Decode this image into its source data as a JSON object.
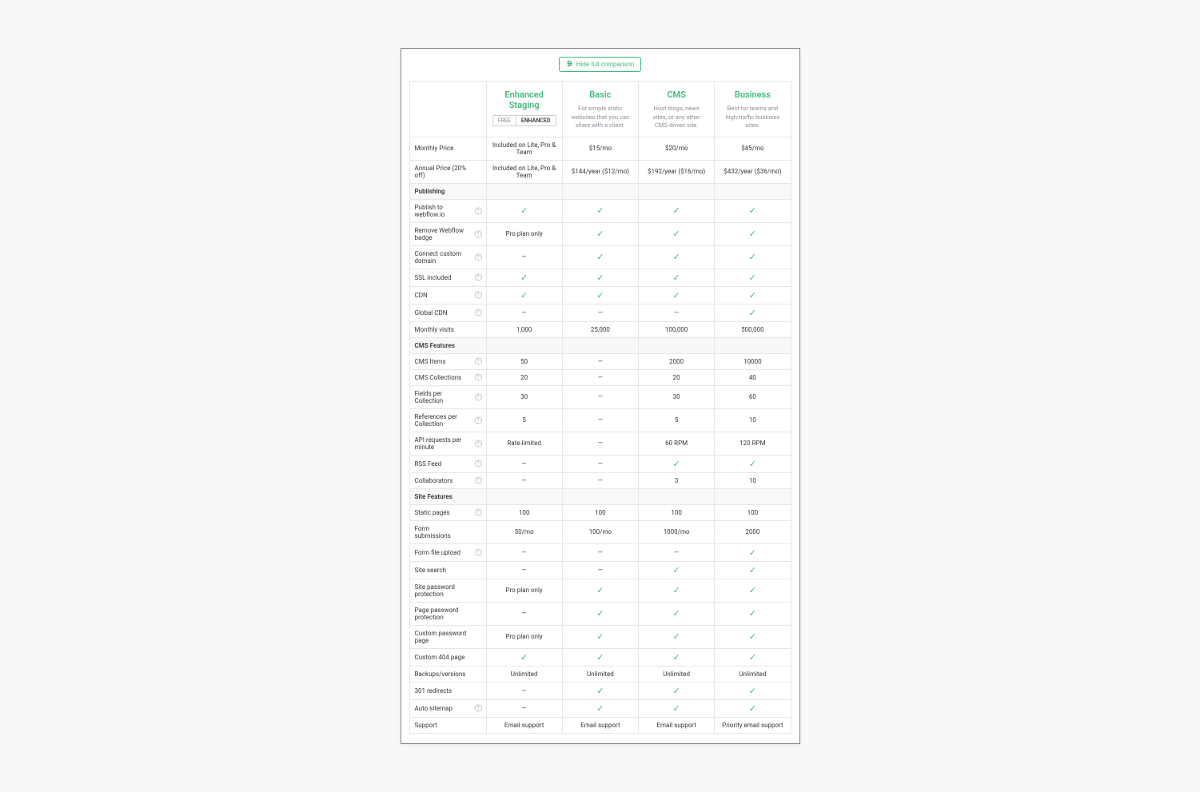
{
  "hide_button": "Hide full comparison",
  "plans": [
    {
      "name": "Enhanced Staging",
      "toggle_free": "FREE",
      "toggle_enhanced": "ENHANCED"
    },
    {
      "name": "Basic",
      "desc": "For simple static websites that you can share with a client."
    },
    {
      "name": "CMS",
      "desc": "Host blogs, news sites, or any other CMS-driven site."
    },
    {
      "name": "Business",
      "desc": "Best for teams and high-traffic business sites."
    }
  ],
  "rows": [
    {
      "label": "Monthly Price",
      "info": false,
      "cells": [
        "Included on Lite, Pro & Team",
        "$15/mo",
        "$20/mo",
        "$45/mo"
      ]
    },
    {
      "label": "Annual Price (20% off)",
      "info": false,
      "cells": [
        "Included on Lite, Pro & Team",
        "$144/year ($12/mo)",
        "$192/year ($16/mo)",
        "$432/year ($36/mo)"
      ]
    },
    {
      "section": "Publishing"
    },
    {
      "label": "Publish to webflow.io",
      "info": true,
      "cells": [
        "check",
        "check",
        "check",
        "check"
      ]
    },
    {
      "label": "Remove Webflow badge",
      "info": true,
      "cells": [
        "Pro plan only",
        "check",
        "check",
        "check"
      ]
    },
    {
      "label": "Connect custom domain",
      "info": true,
      "cells": [
        "dash",
        "check",
        "check",
        "check"
      ]
    },
    {
      "label": "SSL included",
      "info": true,
      "cells": [
        "check",
        "check",
        "check",
        "check"
      ]
    },
    {
      "label": "CDN",
      "info": true,
      "cells": [
        "check",
        "check",
        "check",
        "check"
      ]
    },
    {
      "label": "Global CDN",
      "info": true,
      "cells": [
        "—",
        "—",
        "—",
        "check"
      ]
    },
    {
      "label": "Monthly visits",
      "info": false,
      "cells": [
        "1,000",
        "25,000",
        "100,000",
        "500,000"
      ]
    },
    {
      "section": "CMS Features"
    },
    {
      "label": "CMS Items",
      "info": true,
      "cells": [
        "50",
        "dash",
        "2000",
        "10000"
      ]
    },
    {
      "label": "CMS Collections",
      "info": true,
      "cells": [
        "20",
        "—",
        "20",
        "40"
      ]
    },
    {
      "label": "Fields per Collection",
      "info": true,
      "cells": [
        "30",
        "dash",
        "30",
        "60"
      ]
    },
    {
      "label": "References per Collection",
      "info": true,
      "cells": [
        "5",
        "—",
        "5",
        "10"
      ]
    },
    {
      "label": "API requests per minute",
      "info": true,
      "cells": [
        "Rate-limited",
        "dash",
        "60 RPM",
        "120 RPM"
      ]
    },
    {
      "label": "RSS Feed",
      "info": true,
      "cells": [
        "—",
        "—",
        "check",
        "check"
      ]
    },
    {
      "label": "Collaborators",
      "info": true,
      "cells": [
        "dash",
        "dash",
        "3",
        "10"
      ]
    },
    {
      "section": "Site Features"
    },
    {
      "label": "Static pages",
      "info": true,
      "cells": [
        "100",
        "100",
        "100",
        "100"
      ]
    },
    {
      "label": "Form submissions",
      "info": false,
      "cells": [
        "50/mo",
        "100/mo",
        "1000/mo",
        "2000"
      ]
    },
    {
      "label": "Form file upload",
      "info": true,
      "cells": [
        "dash",
        "dash",
        "dash",
        "check"
      ]
    },
    {
      "label": "Site search",
      "info": false,
      "cells": [
        "—",
        "—",
        "check",
        "check"
      ]
    },
    {
      "label": "Site password protection",
      "info": false,
      "cells": [
        "Pro plan only",
        "check",
        "check",
        "check"
      ]
    },
    {
      "label": "Page password protection",
      "info": false,
      "cells": [
        "—",
        "check",
        "check",
        "check"
      ]
    },
    {
      "label": "Custom password page",
      "info": false,
      "cells": [
        "Pro plan only",
        "check",
        "check",
        "check"
      ]
    },
    {
      "label": "Custom 404 page",
      "info": false,
      "cells": [
        "check",
        "check",
        "check",
        "check"
      ]
    },
    {
      "label": "Backups/versions",
      "info": false,
      "cells": [
        "Unlimited",
        "Unlimited",
        "Unlimited",
        "Unlimited"
      ]
    },
    {
      "label": "301 redirects",
      "info": false,
      "cells": [
        "—",
        "check",
        "check",
        "check"
      ]
    },
    {
      "label": "Auto sitemap",
      "info": true,
      "cells": [
        "dash",
        "check",
        "check",
        "check"
      ]
    },
    {
      "label": "Support",
      "info": false,
      "cells": [
        "Email support",
        "Email support",
        "Email support",
        "Priority email support"
      ]
    }
  ]
}
